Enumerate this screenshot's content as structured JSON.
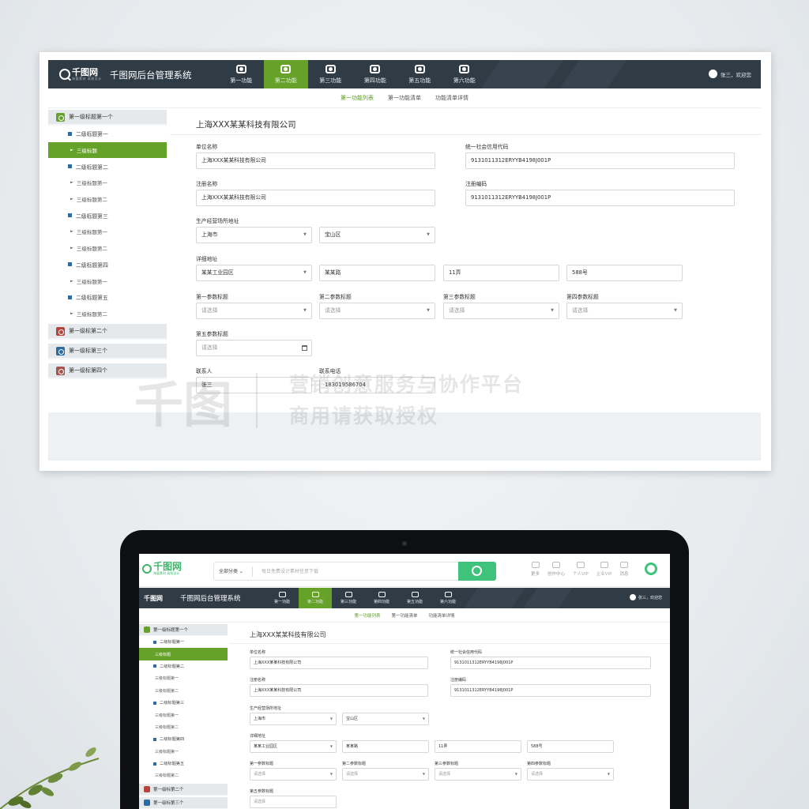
{
  "app": {
    "logo_text": "千图网",
    "logo_sub": "海量素材 高效设计",
    "system_title": "千图网后台管理系统",
    "user_text": "张三，欢迎您"
  },
  "nav": [
    "第一功能",
    "第二功能",
    "第三功能",
    "第四功能",
    "第五功能",
    "第六功能"
  ],
  "subtabs": [
    "第一功能列表",
    "第一功能清单",
    "功能清单详情"
  ],
  "sidebar": {
    "group1": "第一级标题第一个",
    "items": [
      {
        "level": 2,
        "label": "二级标题第一"
      },
      {
        "level": 3,
        "label": "三级标题",
        "active": true
      },
      {
        "level": 2,
        "label": "二级标题第二"
      },
      {
        "level": 3,
        "label": "三级标题第一"
      },
      {
        "level": 3,
        "label": "三级标题第二"
      },
      {
        "level": 2,
        "label": "二级标题第三"
      },
      {
        "level": 3,
        "label": "三级标题第一"
      },
      {
        "level": 3,
        "label": "三级标题第二"
      },
      {
        "level": 2,
        "label": "二级标题第四"
      },
      {
        "level": 3,
        "label": "三级标题第一"
      },
      {
        "level": 2,
        "label": "二级标题第五"
      },
      {
        "level": 3,
        "label": "三级标题第二"
      }
    ],
    "group2": "第一级标第二个",
    "group3": "第一级标第三个",
    "group4": "第一级标第四个",
    "group_colors": [
      "#66a229",
      "#b8433a",
      "#2d6ca0",
      "#a5534b"
    ]
  },
  "form": {
    "company_title": "上海XXX某某科技有限公司",
    "unit_name_label": "单位名称",
    "unit_name_value": "上海XXX某某科技有限公司",
    "credit_code_label": "统一社会信用代码",
    "credit_code_value": "9131011312ERYYB4198J001P",
    "reg_name_label": "注册名称",
    "reg_name_value": "上海XXX某某科技有限公司",
    "reg_code_label": "注册编码",
    "reg_code_value": "9131011312ERYYB4198J001P",
    "address_label": "生产经营场所地址",
    "city_value": "上海市",
    "district_value": "宝山区",
    "detail_label": "详细地址",
    "park_value": "某某工业园区",
    "road_value": "某某路",
    "lane_value": "11弄",
    "number_value": "588号",
    "param1_label": "第一参数标题",
    "param2_label": "第二参数标题",
    "param3_label": "第三参数标题",
    "param4_label": "第四参数标题",
    "param5_label": "第五参数标题",
    "select_placeholder": "请选择",
    "contact_label": "联系人",
    "contact_value": "张三",
    "phone_label": "联系电话",
    "phone_value": "183019586704"
  },
  "watermark": {
    "logo": "千图",
    "line1": "营销创意服务与协作平台",
    "line2": "商用请获取授权"
  },
  "laptop_header": {
    "category": "全部分类",
    "search_placeholder": "每日免费设计素材任意下载",
    "icons": [
      "更多",
      "创作中心",
      "个人VIP",
      "企业VIP",
      "消息"
    ],
    "logo_text": "千图网",
    "logo_sub": "海量素材 高效设计"
  },
  "colors": {
    "accent_green": "#66a229",
    "header_dark": "#2f3b45",
    "brand_green": "#3fc27a"
  }
}
